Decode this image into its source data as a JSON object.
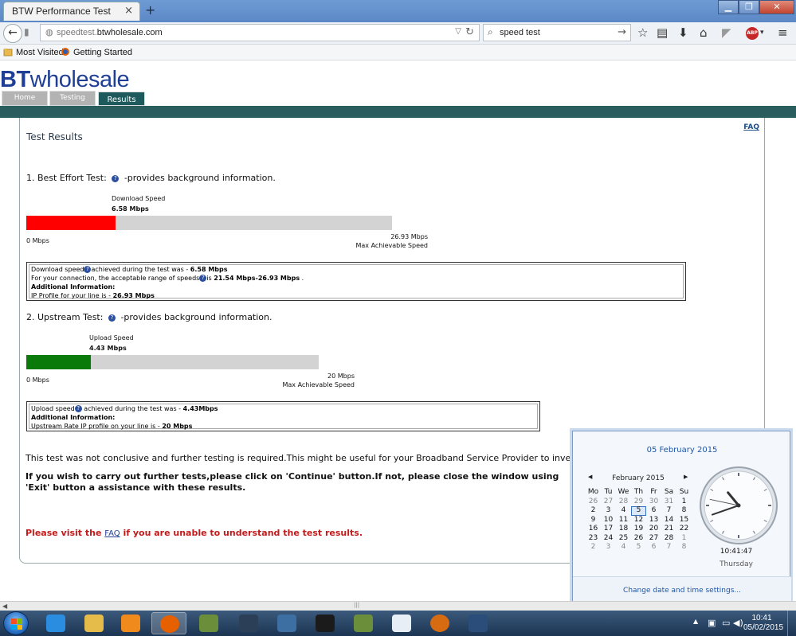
{
  "browser": {
    "tab_title": "BTW Performance Test",
    "tab_close": "×",
    "new_tab": "+",
    "win_minimize": "▁",
    "win_restore": "❐",
    "win_close": "✕",
    "url_prefix": "speedtest.",
    "url_domain": "btwholesale.com",
    "search_value": "speed test",
    "bookmarks": [
      "Most Visited",
      "Getting Started"
    ],
    "abp_label": "ABP"
  },
  "page": {
    "logo_bold": "BT",
    "logo_rest": "wholesale",
    "nav_tabs": [
      "Home",
      "Testing",
      "Results"
    ],
    "faq": "FAQ",
    "title": "Test Results",
    "best_effort": {
      "heading_pre": "1. Best Effort Test:",
      "heading_post": "-provides background information.",
      "info_icon": "?",
      "speed_label": "Download Speed",
      "speed_value": "6.58 Mbps",
      "value": 6.58,
      "max": 26.93,
      "axis_min": "0 Mbps",
      "axis_max": "26.93 Mbps",
      "axis_max_label": "Max Achievable Speed",
      "fill_color": "#ff0000",
      "box": {
        "l1_pre": "Download speed",
        "l1_mid": "achieved during the test was - ",
        "l1_val": "6.58 Mbps",
        "l2_pre": "For your connection, the acceptable range of speeds",
        "l2_mid": "is ",
        "l2_val": "21.54 Mbps-26.93 Mbps",
        "l2_end": " .",
        "l3": "Additional Information:",
        "l4_pre": "IP Profile for your line is - ",
        "l4_val": "26.93 Mbps"
      }
    },
    "upstream": {
      "heading_pre": "2. Upstream Test:",
      "heading_post": "-provides background information.",
      "info_icon": "?",
      "speed_label": "Upload Speed",
      "speed_value": "4.43 Mbps",
      "value": 4.43,
      "max": 20,
      "axis_min": "0 Mbps",
      "axis_max": "20 Mbps",
      "axis_max_label": "Max Achievable Speed",
      "fill_color": "#0a7a0a",
      "box": {
        "l1_pre": "Upload speed",
        "l1_mid": " achieved during the test was - ",
        "l1_val": "4.43Mbps",
        "l2": "Additional Information:",
        "l3_pre": "Upstream Rate IP profile on your line is - ",
        "l3_val": "20 Mbps"
      }
    },
    "conclusion": "This test was not conclusive and further testing is required.This might be useful for your Broadband Service Provider to investigate t",
    "instruction": "If you wish to carry out further tests,please click on 'Continue' button.If not, please close the window using 'Exit' button a assistance with these results.",
    "faq_note_pre": "Please visit the ",
    "faq_note_link": "FAQ",
    "faq_note_post": " if you are unable to understand the test results."
  },
  "clock": {
    "long_date": "05 February 2015",
    "month_label": "February 2015",
    "prev": "◀",
    "next": "▶",
    "weekdays": [
      "Mo",
      "Tu",
      "We",
      "Th",
      "Fr",
      "Sa",
      "Su"
    ],
    "weeks": [
      [
        "26",
        "27",
        "28",
        "29",
        "30",
        "31",
        "1"
      ],
      [
        "2",
        "3",
        "4",
        "5",
        "6",
        "7",
        "8"
      ],
      [
        "9",
        "10",
        "11",
        "12",
        "13",
        "14",
        "15"
      ],
      [
        "16",
        "17",
        "18",
        "19",
        "20",
        "21",
        "22"
      ],
      [
        "23",
        "24",
        "25",
        "26",
        "27",
        "28",
        "1"
      ],
      [
        "2",
        "3",
        "4",
        "5",
        "6",
        "7",
        "8"
      ]
    ],
    "today": "5",
    "time": "10:41:47",
    "day": "Thursday",
    "settings_link": "Change date and time settings..."
  },
  "taskbar": {
    "time": "10:41",
    "date": "05/02/2015"
  }
}
